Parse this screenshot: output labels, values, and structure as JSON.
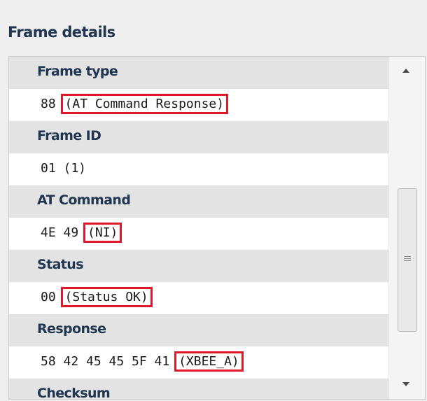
{
  "panel": {
    "title": "Frame details"
  },
  "fields": [
    {
      "label": "Frame type",
      "value_prefix": "88 ",
      "value_highlight": "(AT Command Response)"
    },
    {
      "label": "Frame ID",
      "value_prefix": "01 (1)",
      "value_highlight": ""
    },
    {
      "label": "AT Command",
      "value_prefix": "4E 49 ",
      "value_highlight": "(NI)"
    },
    {
      "label": "Status",
      "value_prefix": "00 ",
      "value_highlight": "(Status OK)"
    },
    {
      "label": "Response",
      "value_prefix": "58 42 45 45 5F 41 ",
      "value_highlight": "(XBEE_A)"
    },
    {
      "label": "Checksum"
    }
  ],
  "scrollbar": {
    "up_icon": "arrow-up-icon",
    "down_icon": "arrow-down-icon",
    "grip_icon": "grip-icon"
  },
  "colors": {
    "title": "#1f3550",
    "highlight_border": "#e0182a",
    "header_bg": "#e3e3e3",
    "panel_bg": "#efefef"
  }
}
